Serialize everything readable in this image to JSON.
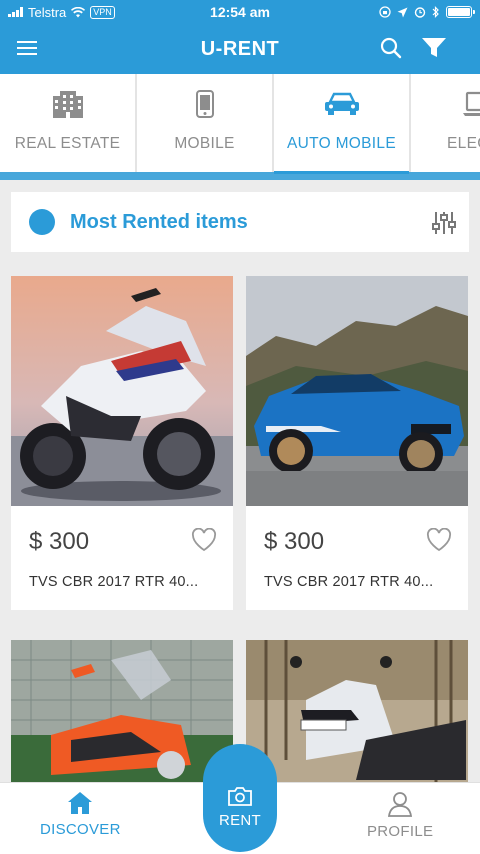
{
  "status": {
    "carrier": "Telstra",
    "vpn": "VPN",
    "time": "12:54 am"
  },
  "app": {
    "title": "U-RENT",
    "icons": [
      "menu-icon",
      "search-icon",
      "filter-icon"
    ]
  },
  "categories": [
    {
      "label": "REAL ESTATE",
      "icon": "building-icon"
    },
    {
      "label": "MOBILE",
      "icon": "phone-icon"
    },
    {
      "label": "AUTO MOBILE",
      "icon": "car-icon",
      "active": true
    },
    {
      "label": "ELECTR",
      "icon": "laptop-icon"
    }
  ],
  "section": {
    "title": "Most Rented items"
  },
  "items": [
    {
      "price": "$ 300",
      "name": "TVS CBR 2017 RTR 40..."
    },
    {
      "price": "$ 300",
      "name": "TVS CBR 2017 RTR 40..."
    },
    {
      "price": "",
      "name": ""
    },
    {
      "price": "",
      "name": ""
    }
  ],
  "nav": {
    "discover": "DISCOVER",
    "rent": "RENT",
    "profile": "PROFILE"
  },
  "colors": {
    "accent": "#2b9bd8",
    "background": "#ececec"
  }
}
